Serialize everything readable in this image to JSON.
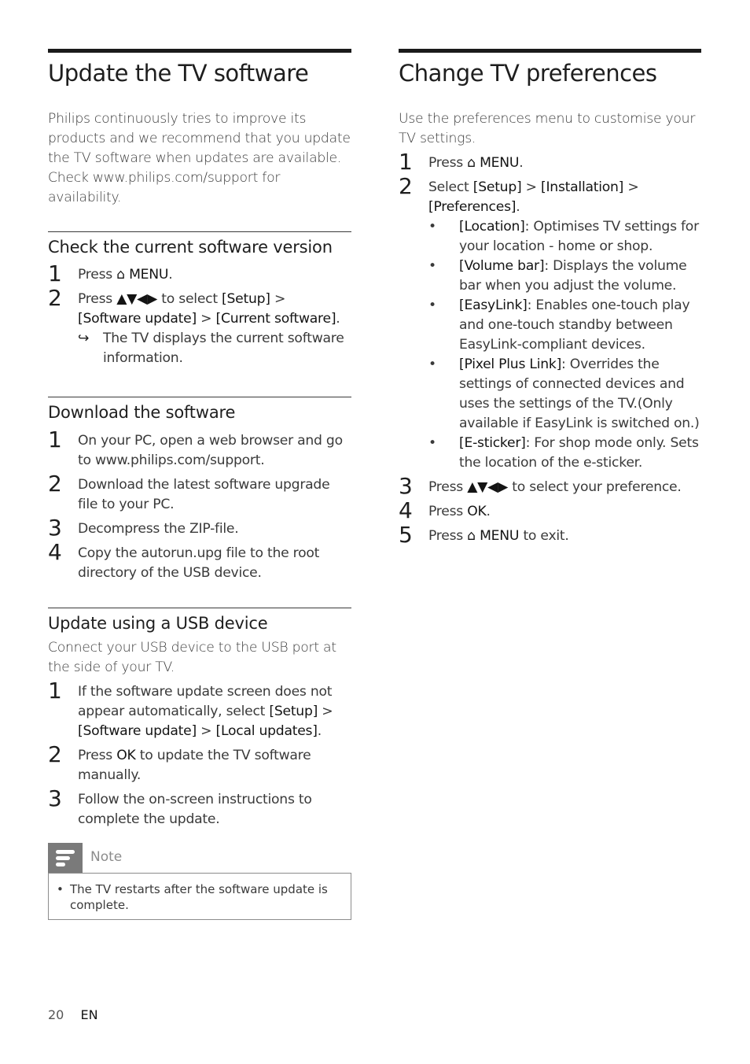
{
  "left": {
    "title": "Update the TV software",
    "intro": "Philips continuously tries to improve its products and we recommend that you update the TV software when updates are available. Check www.philips.com/support for availability.",
    "check": {
      "heading": "Check the current software version",
      "step1": {
        "num": "1",
        "pre": "Press ",
        "icon": "⌂",
        "key": "MENU",
        "post": "."
      },
      "step2": {
        "num": "2",
        "pre": "Press ",
        "arrows": "▲▼◀▶",
        "mid": " to select ",
        "k1": "[Setup]",
        "s1": " > ",
        "k2": "[Software update]",
        "s2": " > ",
        "k3": "[Current software]",
        "post": "."
      },
      "result": {
        "arrow": "↪",
        "text": "The TV displays the current software information."
      }
    },
    "download": {
      "heading": "Download the software",
      "steps": [
        {
          "num": "1",
          "text": "On your PC, open a web browser and go to www.philips.com/support."
        },
        {
          "num": "2",
          "text": "Download the latest software upgrade file to your PC."
        },
        {
          "num": "3",
          "text": "Decompress the ZIP-file."
        },
        {
          "num": "4",
          "text": "Copy the autorun.upg file to the root directory of the USB device."
        }
      ]
    },
    "usb": {
      "heading": "Update using a USB device",
      "intro": "Connect your USB device to the USB port at the side of your TV.",
      "step1": {
        "num": "1",
        "pre": "If the software update screen does not appear automatically, select ",
        "k1": "[Setup]",
        "s1": " > ",
        "k2": "[Software update]",
        "s2": " > ",
        "k3": "[Local updates]",
        "post": "."
      },
      "step2": {
        "num": "2",
        "pre": "Press ",
        "key": "OK",
        "post": " to update the TV software manually."
      },
      "step3": {
        "num": "3",
        "text": "Follow the on-screen instructions to complete the update."
      }
    },
    "note": {
      "label": "Note",
      "bullet": "•",
      "text": "The TV restarts after the software update is complete."
    }
  },
  "right": {
    "title": "Change TV preferences",
    "intro": "Use the preferences menu to customise your TV settings.",
    "step1": {
      "num": "1",
      "pre": "Press ",
      "icon": "⌂",
      "key": "MENU",
      "post": "."
    },
    "step2": {
      "num": "2",
      "pre": "Select ",
      "k1": "[Setup]",
      "s1": " > ",
      "k2": "[Installation]",
      "s2": " > ",
      "k3": "[Preferences]",
      "post": "."
    },
    "options": [
      {
        "key": "[Location]",
        "text": ": Optimises TV settings for your location - home or shop."
      },
      {
        "key": "[Volume bar]",
        "text": ": Displays the volume bar when you adjust the volume."
      },
      {
        "key": "[EasyLink]",
        "text": ": Enables one-touch play and one-touch standby between EasyLink-compliant devices."
      },
      {
        "key": "[Pixel Plus Link]",
        "text": ": Overrides the settings of connected devices and uses the settings of the TV.(Only available if EasyLink is switched on.)"
      },
      {
        "key": "[E-sticker]",
        "text": ": For shop mode only. Sets the location of the e-sticker."
      }
    ],
    "step3": {
      "num": "3",
      "pre": "Press ",
      "arrows": "▲▼◀▶",
      "post": " to select your preference."
    },
    "step4": {
      "num": "4",
      "pre": "Press ",
      "key": "OK",
      "post": "."
    },
    "step5": {
      "num": "5",
      "pre": "Press ",
      "icon": "⌂",
      "key": "MENU",
      "post": " to exit."
    }
  },
  "footer": {
    "page": "20",
    "lang": "EN"
  }
}
